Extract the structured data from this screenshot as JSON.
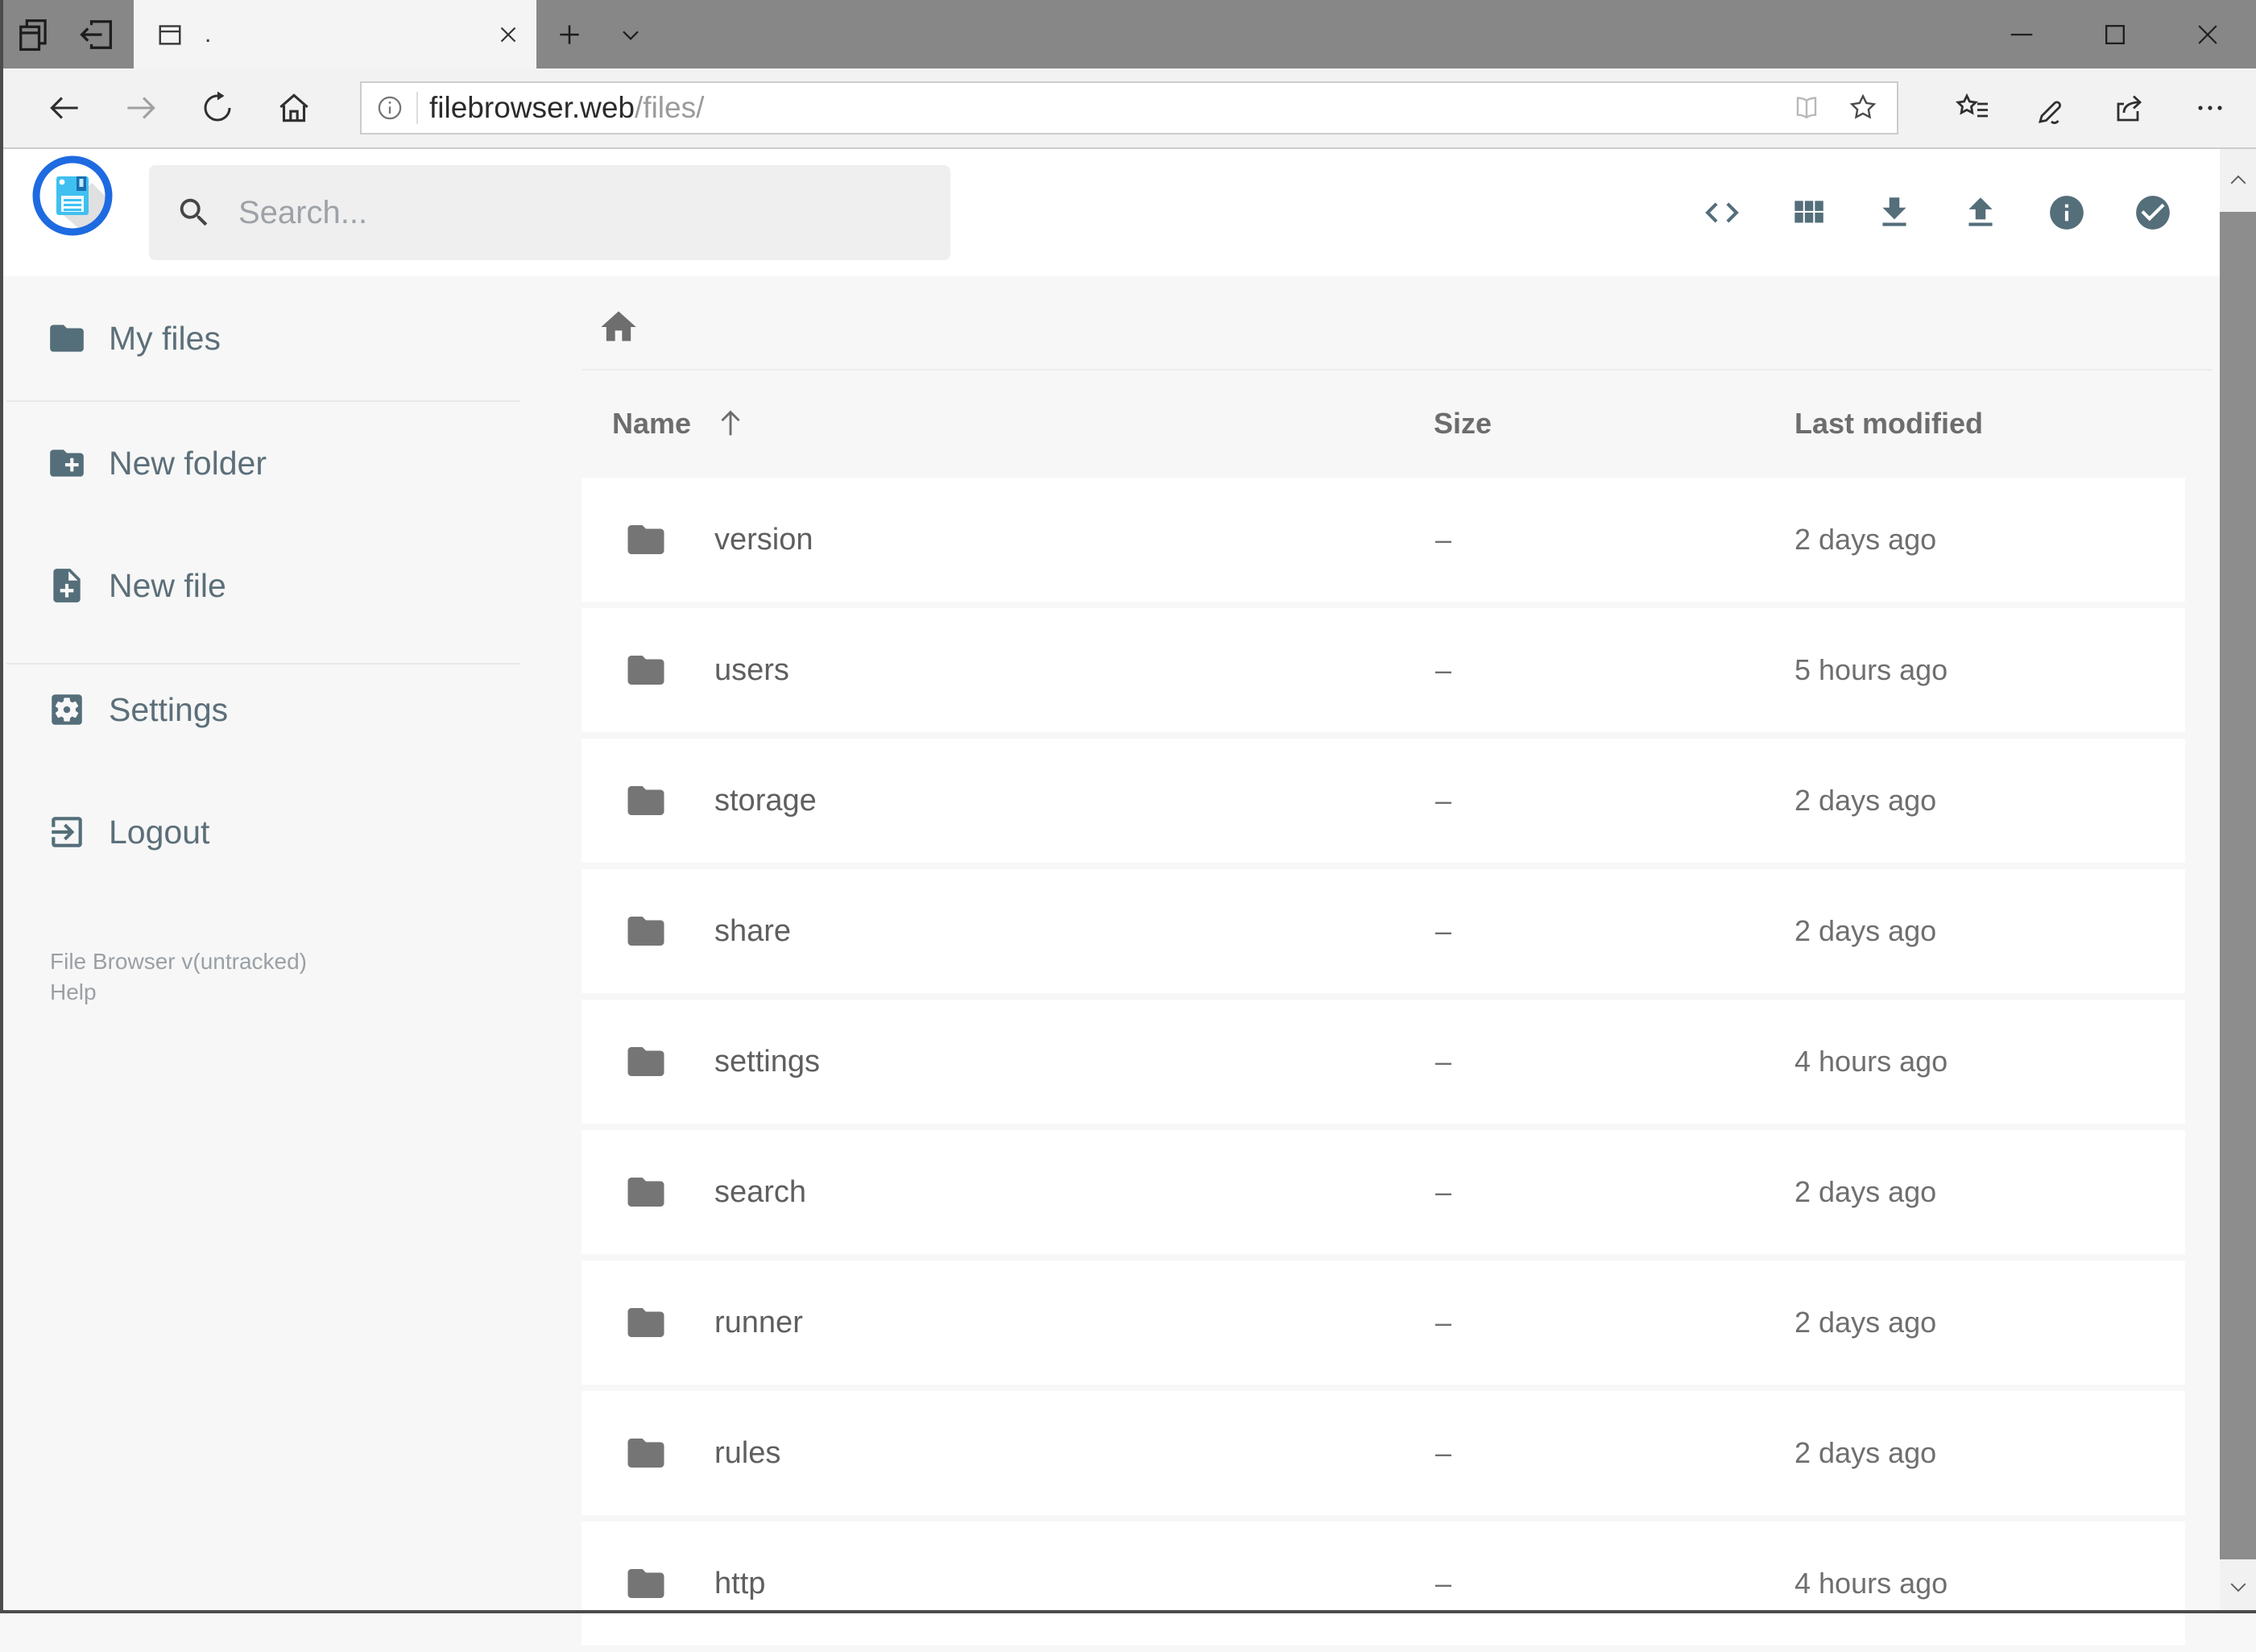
{
  "browser": {
    "tab_title": ".",
    "url_host": "filebrowser.web",
    "url_path": "/files/"
  },
  "header": {
    "search_placeholder": "Search..."
  },
  "sidebar": {
    "items": [
      {
        "label": "My files",
        "icon": "folder-icon"
      },
      {
        "label": "New folder",
        "icon": "new-folder-icon"
      },
      {
        "label": "New file",
        "icon": "new-file-icon"
      },
      {
        "label": "Settings",
        "icon": "settings-icon"
      },
      {
        "label": "Logout",
        "icon": "logout-icon"
      }
    ],
    "footer_version": "File Browser v(untracked)",
    "footer_help": "Help"
  },
  "listing": {
    "columns": {
      "name": "Name",
      "size": "Size",
      "modified": "Last modified"
    },
    "sort": {
      "column": "Name",
      "direction": "ascending"
    },
    "rows": [
      {
        "name": "version",
        "size": "–",
        "modified": "2 days ago"
      },
      {
        "name": "users",
        "size": "–",
        "modified": "5 hours ago"
      },
      {
        "name": "storage",
        "size": "–",
        "modified": "2 days ago"
      },
      {
        "name": "share",
        "size": "–",
        "modified": "2 days ago"
      },
      {
        "name": "settings",
        "size": "–",
        "modified": "4 hours ago"
      },
      {
        "name": "search",
        "size": "–",
        "modified": "2 days ago"
      },
      {
        "name": "runner",
        "size": "–",
        "modified": "2 days ago"
      },
      {
        "name": "rules",
        "size": "–",
        "modified": "2 days ago"
      },
      {
        "name": "http",
        "size": "–",
        "modified": "4 hours ago"
      }
    ]
  },
  "colors": {
    "accent_blue": "#1e6ae1",
    "icon_slate": "#546e7a",
    "folder_gray": "#757575",
    "titlebar_gray": "#878787",
    "content_bg": "#f7f7f7"
  }
}
